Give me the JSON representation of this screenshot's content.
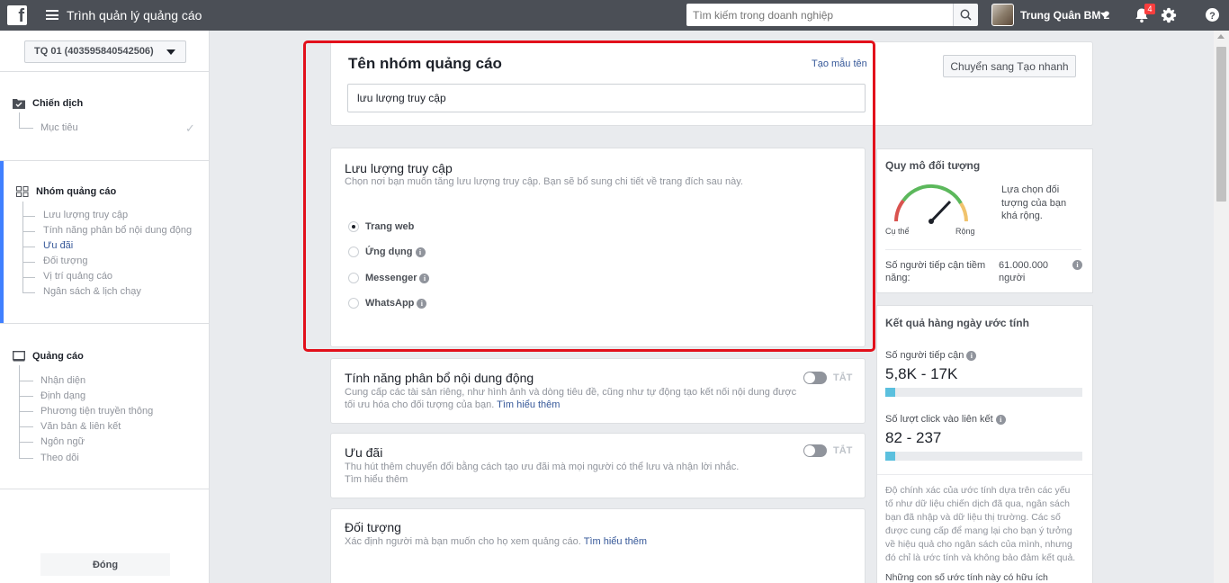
{
  "topbar": {
    "logo_letter": "f",
    "app_title": "Trình quản lý quảng cáo",
    "search_placeholder": "Tìm kiếm trong doanh nghiệp",
    "user_name": "Trung Quân BM 2",
    "notification_count": "4"
  },
  "sidebar": {
    "account": "TQ 01 (403595840542506)",
    "campaign": {
      "label": "Chiến dịch",
      "items": [
        "Mục tiêu"
      ]
    },
    "adset": {
      "label": "Nhóm quảng cáo",
      "items": [
        "Lưu lượng truy cập",
        "Tính năng phân bổ nội dung động",
        "Ưu đãi",
        "Đối tượng",
        "Vị trí quảng cáo",
        "Ngân sách & lịch chạy"
      ]
    },
    "ad": {
      "label": "Quảng cáo",
      "items": [
        "Nhận diện",
        "Định dạng",
        "Phương tiện truyền thông",
        "Văn bản & liên kết",
        "Ngôn ngữ",
        "Theo dõi"
      ]
    },
    "close_label": "Đóng"
  },
  "adset_name": {
    "title": "Tên nhóm quảng cáo",
    "template_link": "Tạo mẫu tên",
    "value": "lưu lượng truy cập",
    "switch_button": "Chuyển sang Tạo nhanh"
  },
  "traffic": {
    "title": "Lưu lượng truy cập",
    "subtitle": "Chọn nơi bạn muốn tăng lưu lượng truy cập. Bạn sẽ bổ sung chi tiết về trang đích sau này.",
    "options": [
      {
        "label": "Trang web",
        "selected": true
      },
      {
        "label": "Ứng dụng",
        "selected": false
      },
      {
        "label": "Messenger",
        "selected": false
      },
      {
        "label": "WhatsApp",
        "selected": false
      }
    ]
  },
  "dynamic_creative": {
    "title": "Tính năng phân bổ nội dung động",
    "desc_line1": "Cung cấp các tài sản riêng, như hình ảnh và dòng tiêu đề, cũng như tự động tạo kết nối nội dung được",
    "desc_line2": "tối ưu hóa cho đối tượng của bạn.",
    "learn_more": "Tìm hiểu thêm",
    "toggle_label": "TẮT"
  },
  "offer": {
    "title": "Ưu đãi",
    "desc": "Thu hút thêm chuyển đổi bằng cách tạo ưu đãi mà mọi người có thể lưu và nhận lời nhắc.",
    "learn_more": "Tìm hiểu thêm",
    "toggle_label": "TẮT"
  },
  "audience": {
    "title": "Đối tượng",
    "desc": "Xác định người mà bạn muốn cho họ xem quảng cáo.",
    "learn_more": "Tìm hiểu thêm"
  },
  "audience_size": {
    "title": "Quy mô đối tượng",
    "gauge_left": "Cụ thể",
    "gauge_right": "Rộng",
    "note_line1": "Lựa chọn đối",
    "note_line2": "tượng của bạn",
    "note_line3": "khá rộng.",
    "reach_label_line1": "Số người tiếp cận tiềm",
    "reach_label_line2": "năng:",
    "reach_value_line1": "61.000.000",
    "reach_value_line2": "người"
  },
  "daily_results": {
    "title": "Kết quả hàng ngày ước tính",
    "reach_label": "Số người tiếp cận",
    "reach_value": "5,8K - 17K",
    "reach_fill": 0.05,
    "clicks_label": "Số lượt click vào liên kết",
    "clicks_value": "82 - 237",
    "clicks_fill": 0.05,
    "disclaimer": [
      "Độ chính xác của ước tính dựa trên các yếu",
      "tố như dữ liệu chiến dịch đã qua, ngân sách",
      "bạn đã nhập và dữ liệu thị trường. Các số",
      "được cung cấp để mang lại cho bạn ý tưởng",
      "về hiệu quả cho ngân sách của mình, nhưng",
      "đó chỉ là ước tính và không bảo đảm kết quả."
    ],
    "more_link": "Những con số ước tính này có hữu ích"
  }
}
